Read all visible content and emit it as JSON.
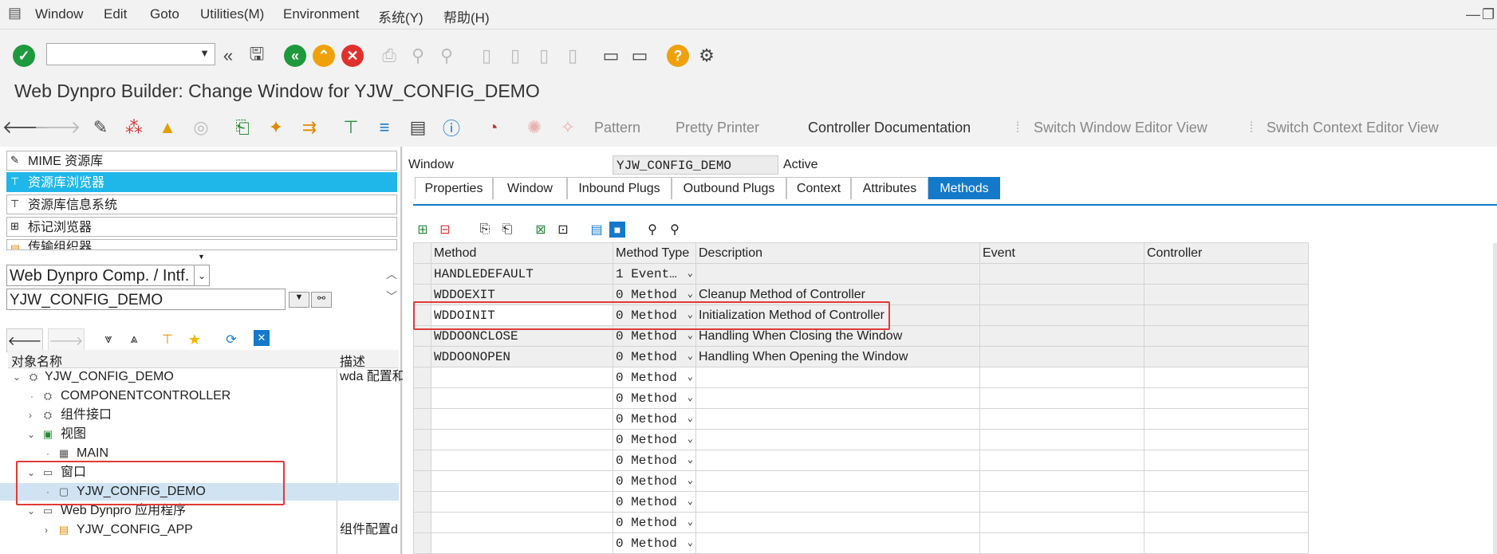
{
  "menu": {
    "items": [
      "Window",
      "Edit",
      "Goto",
      "Utilities(M)",
      "Environment",
      "系统(Y)",
      "帮助(H)"
    ]
  },
  "toolbar": {
    "command_value": "",
    "icons": [
      "enter-icon",
      "command-field",
      "back-double-icon",
      "save-icon",
      "back-icon",
      "exit-icon",
      "cancel-icon",
      "print-icon",
      "find-icon",
      "find-next-icon",
      "first-page-icon",
      "prev-page-icon",
      "next-page-icon",
      "last-page-icon",
      "create-session-icon",
      "shortcut-icon",
      "help-icon",
      "customize-icon"
    ]
  },
  "page": {
    "title": "Web Dynpro Builder: Change Window for YJW_CONFIG_DEMO"
  },
  "app_toolbar": {
    "pattern": "Pattern",
    "pretty_printer": "Pretty Printer",
    "controller_documentation": "Controller Documentation",
    "switch_window_editor": "Switch Window Editor View",
    "switch_context_editor": "Switch Context Editor View"
  },
  "navigator": {
    "items": [
      {
        "label": "MIME 资源库",
        "selected": false
      },
      {
        "label": "资源库浏览器",
        "selected": true
      },
      {
        "label": "资源库信息系统",
        "selected": false
      },
      {
        "label": "标记浏览器",
        "selected": false
      },
      {
        "label": "传输组织器",
        "selected": false
      }
    ],
    "object_type": "Web Dynpro Comp. / Intf.",
    "object_name": "YJW_CONFIG_DEMO",
    "tree_columns": [
      "对象名称",
      "描述"
    ],
    "tree": [
      {
        "label": "YJW_CONFIG_DEMO",
        "desc": "wda 配置和"
      },
      {
        "label": "COMPONENTCONTROLLER",
        "desc": ""
      },
      {
        "label": "组件接口",
        "desc": ""
      },
      {
        "label": "视图",
        "desc": ""
      },
      {
        "label": "MAIN",
        "desc": ""
      },
      {
        "label": "窗口",
        "desc": ""
      },
      {
        "label": "YJW_CONFIG_DEMO",
        "desc": ""
      },
      {
        "label": "Web Dynpro 应用程序",
        "desc": ""
      },
      {
        "label": "YJW_CONFIG_APP",
        "desc": "组件配置d"
      }
    ]
  },
  "editor": {
    "window_label": "Window",
    "window_value": "YJW_CONFIG_DEMO",
    "status": "Active",
    "tabs": [
      "Properties",
      "Window",
      "Inbound Plugs",
      "Outbound Plugs",
      "Context",
      "Attributes",
      "Methods"
    ],
    "active_tab": "Methods",
    "columns": [
      "Method",
      "Method Type",
      "Description",
      "Event",
      "Controller"
    ],
    "rows": [
      {
        "method": "HANDLEDEFAULT",
        "type": "1 Event…",
        "desc": ""
      },
      {
        "method": "WDDOEXIT",
        "type": "0 Method",
        "desc": "Cleanup Method of Controller"
      },
      {
        "method": "WDDOINIT",
        "type": "0 Method",
        "desc": "Initialization Method of Controller"
      },
      {
        "method": "WDDOONCLOSE",
        "type": "0 Method",
        "desc": "Handling When Closing the Window"
      },
      {
        "method": "WDDOONOPEN",
        "type": "0 Method",
        "desc": "Handling When Opening the Window"
      },
      {
        "method": "",
        "type": "0 Method",
        "desc": ""
      },
      {
        "method": "",
        "type": "0 Method",
        "desc": ""
      },
      {
        "method": "",
        "type": "0 Method",
        "desc": ""
      },
      {
        "method": "",
        "type": "0 Method",
        "desc": ""
      },
      {
        "method": "",
        "type": "0 Method",
        "desc": ""
      },
      {
        "method": "",
        "type": "0 Method",
        "desc": ""
      },
      {
        "method": "",
        "type": "0 Method",
        "desc": ""
      },
      {
        "method": "",
        "type": "0 Method",
        "desc": ""
      },
      {
        "method": "",
        "type": "0 Method",
        "desc": ""
      }
    ]
  },
  "colors": {
    "accent": "#1fb7ea",
    "tab_active": "#1479c9",
    "highlight_box": "#e03a3a"
  }
}
